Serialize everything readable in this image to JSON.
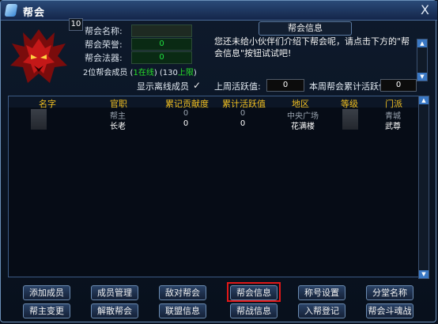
{
  "window": {
    "title": "帮会",
    "close_label": "X"
  },
  "guild": {
    "level": "10",
    "name_label": "帮会名称:",
    "honor_label": "帮会荣誉:",
    "honor_value": "0",
    "artifact_label": "帮会法器:",
    "artifact_value": "0",
    "members_prefix": "2位帮会成员 (",
    "members_online": "1在线",
    "members_mid": ") (130",
    "members_limit": "上限",
    "members_suffix": ")"
  },
  "notice": {
    "tab_label": "帮会信息",
    "text": "您还未给小伙伴们介绍下帮会呢，请点击下方的\"帮会信息\"按钮试试吧!"
  },
  "filters": {
    "show_offline_label": "显示离线成员",
    "show_offline_checked": true,
    "last_week_label": "上周活跃值:",
    "last_week_value": "0",
    "week_total_label": "本周帮会累计活跃值:",
    "week_total_value": "0"
  },
  "table": {
    "headers": [
      "名字",
      "官职",
      "累记贡献度",
      "累计活跃值",
      "地区",
      "等级",
      "门派"
    ],
    "rows": [
      {
        "name": "",
        "rank": "帮主",
        "contrib": "0",
        "active": "0",
        "region": "中央广场",
        "level": "",
        "sect": "青城",
        "color": "#9aa4b0"
      },
      {
        "name": "",
        "rank": "长老",
        "contrib": "0",
        "active": "0",
        "region": "花满楼",
        "level": "",
        "sect": "武尊",
        "color": "#ffffff"
      }
    ]
  },
  "buttons": {
    "row1": [
      "添加成员",
      "成员管理",
      "敌对帮会",
      "帮会信息",
      "称号设置",
      "分堂名称"
    ],
    "row2": [
      "帮主变更",
      "解散帮会",
      "联盟信息",
      "帮战信息",
      "入帮登记",
      "帮会斗魂战"
    ]
  }
}
